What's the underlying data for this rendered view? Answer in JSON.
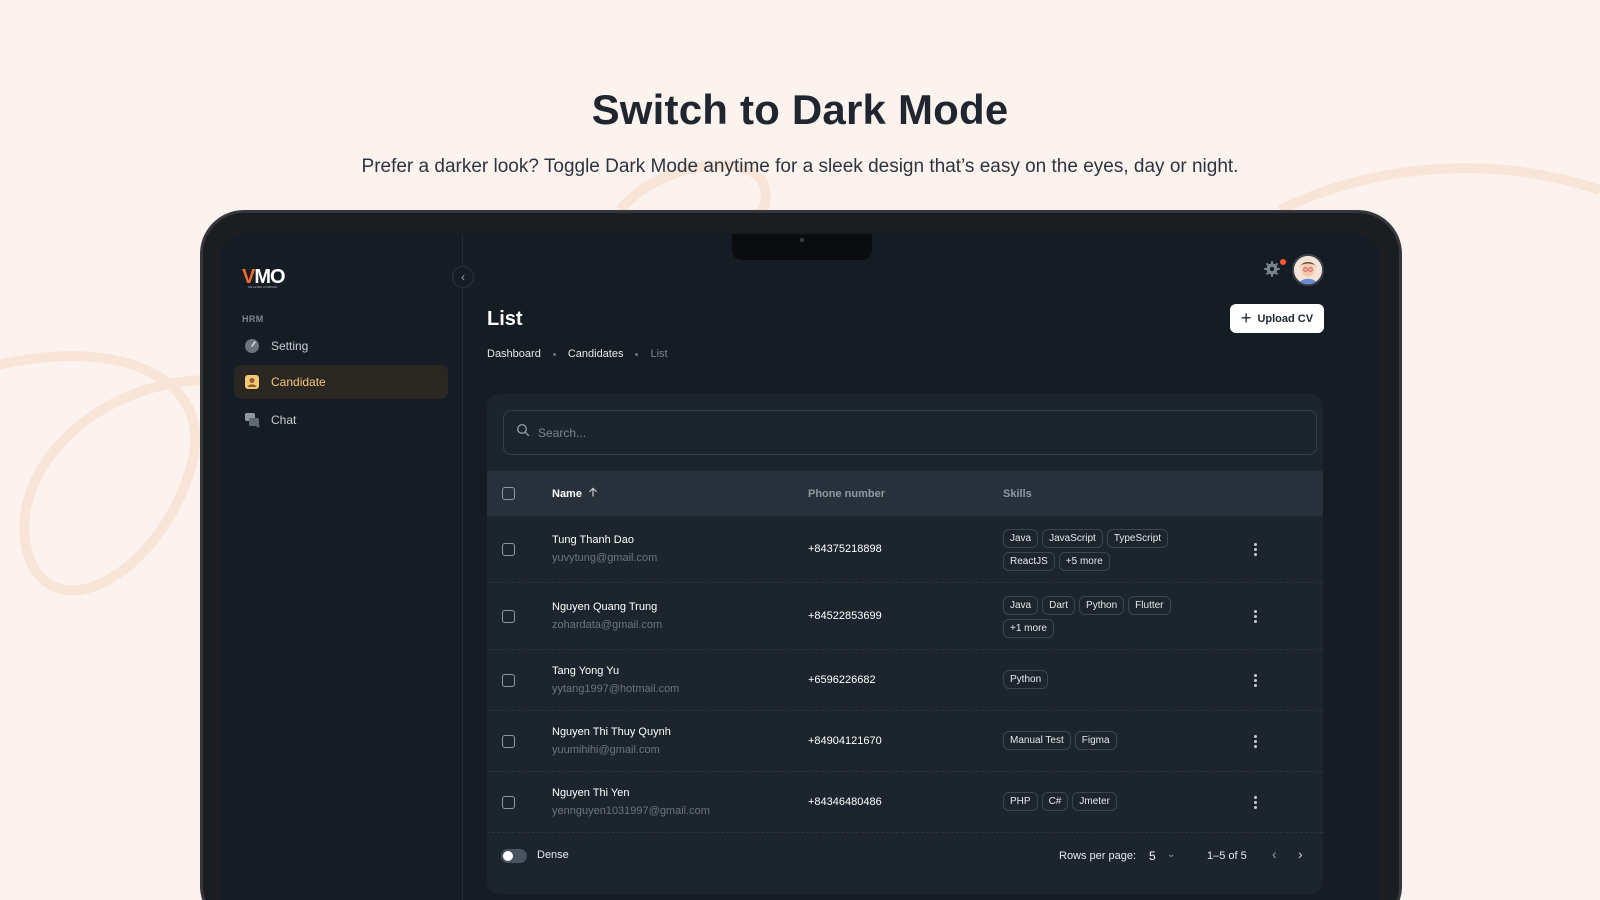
{
  "hero": {
    "title": "Switch to Dark Mode",
    "subtitle": "Prefer a darker look? Toggle Dark Mode anytime for a sleek design that’s easy on the eyes, day or night."
  },
  "app": {
    "logo_v": "V",
    "logo_mo": "MO",
    "logo_sub": "AN ALTEN COMPANY",
    "collapse_icon": "chevron-left-icon"
  },
  "sidebar": {
    "section_label": "HRM",
    "items": [
      {
        "label": "Setting",
        "icon": "speedometer-icon",
        "active": false
      },
      {
        "label": "Candidate",
        "icon": "user-card-icon",
        "active": true
      },
      {
        "label": "Chat",
        "icon": "chat-icon",
        "active": false
      }
    ]
  },
  "header": {
    "settings_icon": "gear-icon",
    "notification_color": "#ff5630",
    "avatar": "user-avatar"
  },
  "page": {
    "title": "List",
    "upload_label": "Upload CV",
    "breadcrumb": [
      "Dashboard",
      "Candidates",
      "List"
    ]
  },
  "search": {
    "placeholder": "Search..."
  },
  "table": {
    "columns": [
      "Name",
      "Phone number",
      "Skills"
    ],
    "sort_icon": "arrow-up-icon",
    "rows": [
      {
        "name": "Tung Thanh Dao",
        "email": "yuvytung@gmail.com",
        "phone": "+84375218898",
        "skills": [
          "Java",
          "JavaScript",
          "TypeScript",
          "ReactJS",
          "+5 more"
        ]
      },
      {
        "name": "Nguyen Quang Trung",
        "email": "zohardata@gmail.com",
        "phone": "+84522853699",
        "skills": [
          "Java",
          "Dart",
          "Python",
          "Flutter",
          "+1 more"
        ]
      },
      {
        "name": "Tang Yong Yu",
        "email": "yytang1997@hotmail.com",
        "phone": "+6596226682",
        "skills": [
          "Python"
        ]
      },
      {
        "name": "Nguyen Thi Thuy Quynh",
        "email": "yuumihihi@gmail.com",
        "phone": "+84904121670",
        "skills": [
          "Manual Test",
          "Figma"
        ]
      },
      {
        "name": "Nguyen Thi Yen",
        "email": "yennguyen1031997@gmail.com",
        "phone": "+84346480486",
        "skills": [
          "PHP",
          "C#",
          "Jmeter"
        ]
      }
    ]
  },
  "footer": {
    "dense_label": "Dense",
    "dense_on": false,
    "rows_per_page_label": "Rows per page:",
    "rows_per_page": "5",
    "range": "1–5 of 5"
  },
  "colors": {
    "page_bg": "#fdf3ee",
    "screen_bg": "#161c24",
    "accent": "#f4c779",
    "brand": "#f26b2c"
  }
}
